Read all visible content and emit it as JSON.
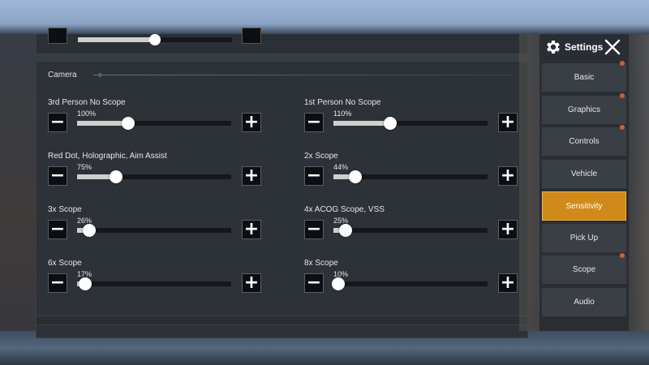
{
  "sidebar": {
    "title": "Settings",
    "items": [
      {
        "label": "Basic",
        "active": false,
        "dot": true
      },
      {
        "label": "Graphics",
        "active": false,
        "dot": true
      },
      {
        "label": "Controls",
        "active": false,
        "dot": true
      },
      {
        "label": "Vehicle",
        "active": false,
        "dot": false
      },
      {
        "label": "Sensitivity",
        "active": true,
        "dot": false
      },
      {
        "label": "Pick Up",
        "active": false,
        "dot": false
      },
      {
        "label": "Scope",
        "active": false,
        "dot": true
      },
      {
        "label": "Audio",
        "active": false,
        "dot": false
      }
    ]
  },
  "previous_slider": {
    "value_percent": 50
  },
  "camera": {
    "title": "Camera",
    "settings": [
      {
        "label": "3rd Person No Scope",
        "value": "100%",
        "fraction": 0.33
      },
      {
        "label": "1st Person No Scope",
        "value": "110%",
        "fraction": 0.37
      },
      {
        "label": "Red Dot, Holographic, Aim Assist",
        "value": "75%",
        "fraction": 0.25
      },
      {
        "label": "2x Scope",
        "value": "44%",
        "fraction": 0.14
      },
      {
        "label": "3x Scope",
        "value": "26%",
        "fraction": 0.08
      },
      {
        "label": "4x ACOG Scope, VSS",
        "value": "25%",
        "fraction": 0.08
      },
      {
        "label": "6x Scope",
        "value": "17%",
        "fraction": 0.05
      },
      {
        "label": "8x Scope",
        "value": "10%",
        "fraction": 0.03
      }
    ]
  },
  "colors": {
    "accent": "#cf8a1a",
    "dot": "#e0563f",
    "track": "#15171a",
    "fill": "#cfcfcf"
  },
  "icons": {
    "settings": "gear-icon",
    "close": "close-icon",
    "minus": "minus-icon",
    "plus": "plus-icon"
  }
}
